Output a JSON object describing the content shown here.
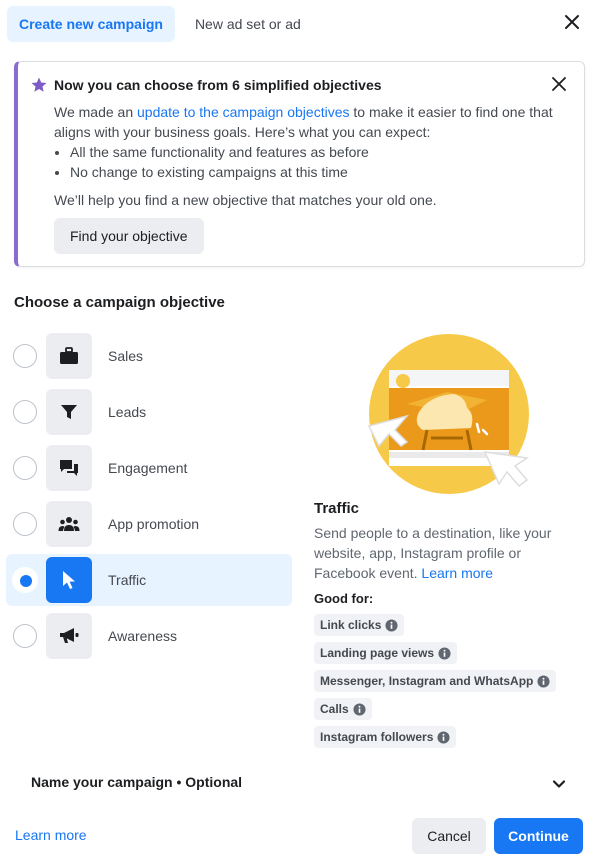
{
  "tabs": [
    {
      "label": "Create new campaign",
      "active": true
    },
    {
      "label": "New ad set or ad",
      "active": false
    }
  ],
  "notice": {
    "title": "Now you can choose from 6 simplified objectives",
    "body_before_link": "We made an ",
    "link_text": "update to the campaign objectives",
    "body_after_link": " to make it easier to find one that aligns with your business goals. Here’s what you can expect:",
    "bullets": [
      "All the same functionality and features as before",
      "No change to existing campaigns at this time"
    ],
    "help_text": "We’ll help you find a new objective that matches your old one.",
    "button_label": "Find your objective",
    "accent_color": "#8b6bd0"
  },
  "section_title": "Choose a campaign objective",
  "objectives": [
    {
      "label": "Sales",
      "icon": "briefcase-icon",
      "selected": false
    },
    {
      "label": "Leads",
      "icon": "funnel-icon",
      "selected": false
    },
    {
      "label": "Engagement",
      "icon": "chat-bubbles-icon",
      "selected": false
    },
    {
      "label": "App promotion",
      "icon": "people-icon",
      "selected": false
    },
    {
      "label": "Traffic",
      "icon": "cursor-icon",
      "selected": true
    },
    {
      "label": "Awareness",
      "icon": "megaphone-icon",
      "selected": false
    }
  ],
  "detail": {
    "title": "Traffic",
    "description": "Send people to a destination, like your website, app, Instagram profile or Facebook event. ",
    "learn_more": "Learn more",
    "good_for_label": "Good for:",
    "good_for": [
      "Link clicks",
      "Landing page views",
      "Messenger, Instagram and WhatsApp",
      "Calls",
      "Instagram followers"
    ]
  },
  "name_campaign_label": "Name your campaign • Optional",
  "footer": {
    "learn_more": "Learn more",
    "cancel_label": "Cancel",
    "continue_label": "Continue"
  },
  "colors": {
    "brand_blue": "#1877f2",
    "selected_bg": "#e7f3ff",
    "illustration_yellow": "#f7c948",
    "illustration_orange": "#e9910a"
  }
}
